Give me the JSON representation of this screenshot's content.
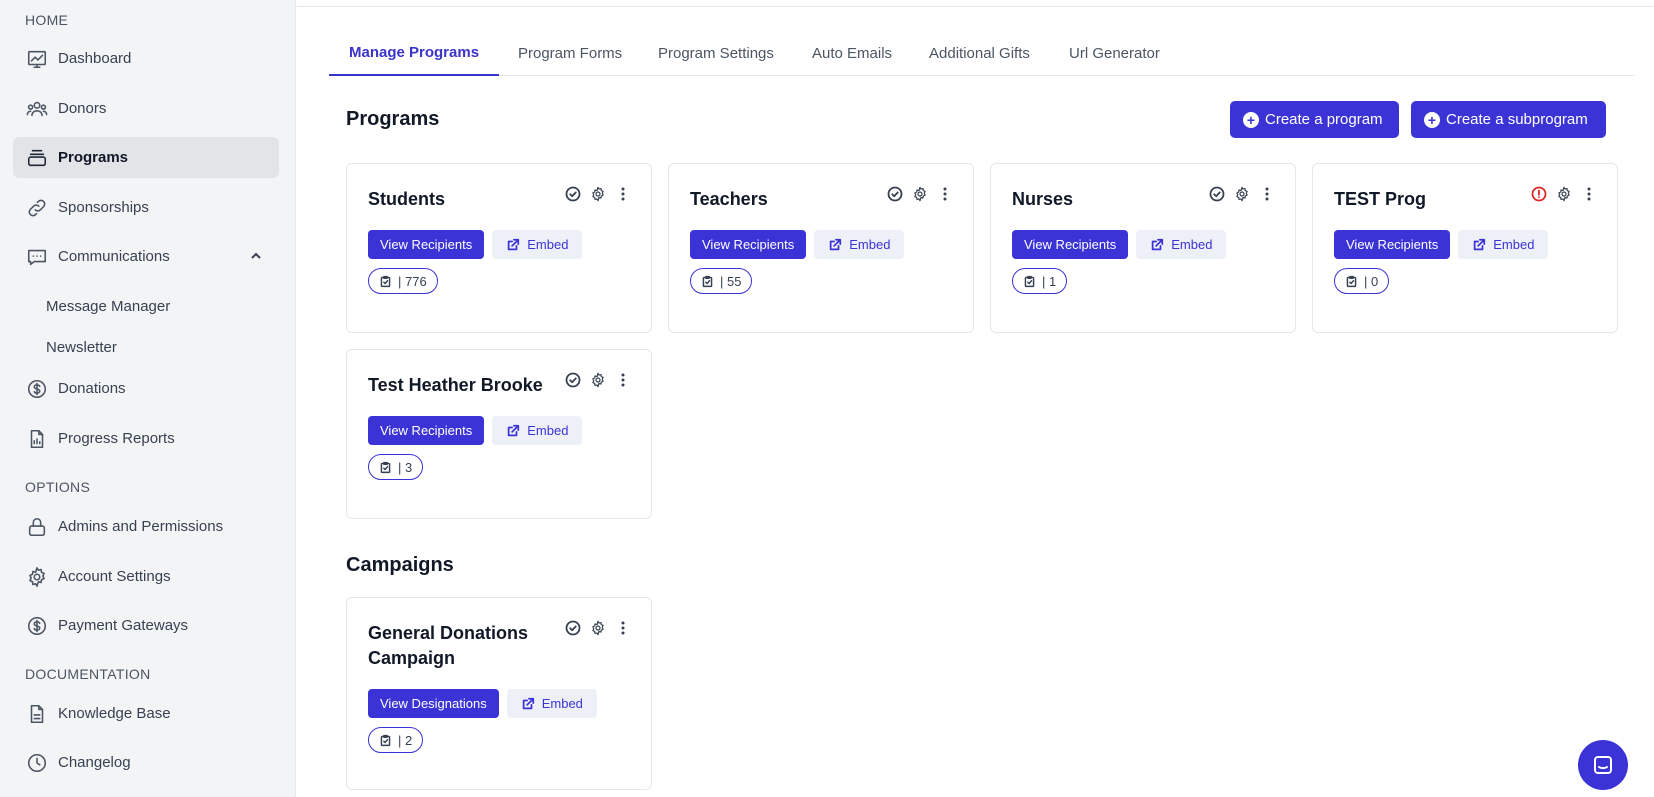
{
  "sidebar": {
    "sections": {
      "home": "HOME",
      "options": "OPTIONS",
      "documentation": "DOCUMENTATION"
    },
    "items": {
      "dashboard": "Dashboard",
      "donors": "Donors",
      "programs": "Programs",
      "sponsorships": "Sponsorships",
      "communications": "Communications",
      "message_manager": "Message Manager",
      "newsletter": "Newsletter",
      "donations": "Donations",
      "progress_reports": "Progress Reports",
      "admins": "Admins and Permissions",
      "account_settings": "Account Settings",
      "payment_gateways": "Payment Gateways",
      "knowledge_base": "Knowledge Base",
      "changelog": "Changelog"
    }
  },
  "tabs": [
    {
      "label": "Manage Programs"
    },
    {
      "label": "Program Forms"
    },
    {
      "label": "Program Settings"
    },
    {
      "label": "Auto Emails"
    },
    {
      "label": "Additional Gifts"
    },
    {
      "label": "Url Generator"
    }
  ],
  "programs": {
    "title": "Programs",
    "create_program": "Create a program",
    "create_subprogram": "Create a subprogram",
    "cards": [
      {
        "title": "Students",
        "count": "| 776",
        "status": "ok",
        "view_label": "View Recipients",
        "embed_label": "Embed"
      },
      {
        "title": "Teachers",
        "count": "| 55",
        "status": "ok",
        "view_label": "View Recipients",
        "embed_label": "Embed"
      },
      {
        "title": "Nurses",
        "count": "| 1",
        "status": "ok",
        "view_label": "View Recipients",
        "embed_label": "Embed"
      },
      {
        "title": "TEST Prog",
        "count": "| 0",
        "status": "warning",
        "view_label": "View Recipients",
        "embed_label": "Embed"
      },
      {
        "title": "Test Heather Brooke",
        "count": "| 3",
        "status": "ok",
        "view_label": "View Recipients",
        "embed_label": "Embed"
      }
    ]
  },
  "campaigns": {
    "title": "Campaigns",
    "cards": [
      {
        "title": "General Donations Campaign",
        "count": "| 2",
        "status": "ok",
        "view_label": "View Designations",
        "embed_label": "Embed"
      }
    ]
  },
  "colors": {
    "accent": "#3b33d6",
    "warning": "#dc2626",
    "sidebar_bg": "#f3f4f6"
  }
}
